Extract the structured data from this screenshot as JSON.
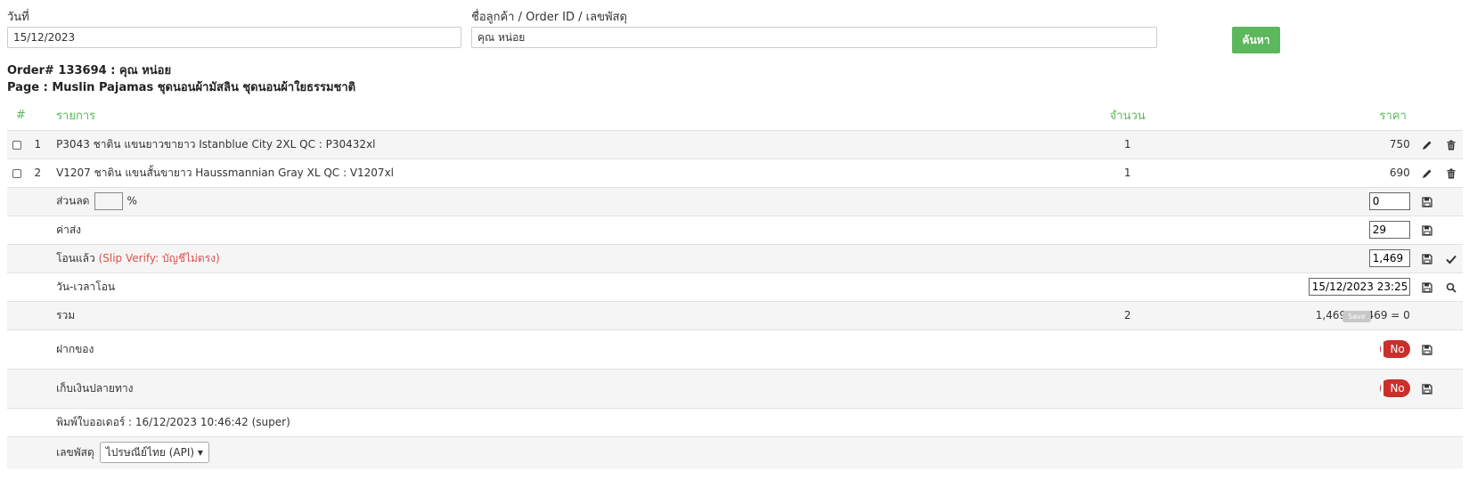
{
  "search": {
    "date_label": "วันที่",
    "date_value": "15/12/2023",
    "customer_label": "ชื่อลูกค้า / Order ID / เลขพัสดุ",
    "customer_value": "คุณ หน่อย",
    "search_label": "ค้นหา"
  },
  "order": {
    "title": "Order# 133694 : คุณ หน่อย",
    "page": "Page : Muslin Pajamas ชุดนอนผ้ามัสลิน ชุดนอนผ้าใยธรรมชาติ"
  },
  "table": {
    "headers": {
      "num": "#",
      "item": "รายการ",
      "qty": "จำนวน",
      "price": "ราคา"
    },
    "rows": [
      {
        "num": "1",
        "item": "P3043 ชาติน แขนยาวขายาว Istanblue City 2XL QC : P30432xl",
        "qty": "1",
        "price": "750"
      },
      {
        "num": "2",
        "item": "V1207 ชาติน แขนสั้นขายาว Haussmannian Gray XL QC : V1207xl",
        "qty": "1",
        "price": "690"
      }
    ]
  },
  "summary": {
    "discount_label": "ส่วนลด",
    "discount_pct_unit": "%",
    "discount_value": "0",
    "shipping_label": "ค่าส่ง",
    "shipping_value": "29",
    "transferred_label": "โอนแล้ว",
    "transferred_note": "(Slip Verify: บัญชีไม่ตรง)",
    "transferred_value": "1,469",
    "transfer_time_label": "วัน-เวลาโอน",
    "transfer_time_value": "15/12/2023 23:25",
    "total_label": "รวม",
    "total_qty": "2",
    "total_value": "1,469 - 1,469 = 0",
    "deposit_label": "ฝากของ",
    "deposit_toggle": "No",
    "cod_label": "เก็บเงินปลายทาง",
    "cod_toggle": "No",
    "printed_text": "พิมพ์ใบออเดอร์ : 16/12/2023 10:46:42 (super)",
    "tracking_label": "เลขพัสดุ",
    "tracking_carrier": "ไปรษณีย์ไทย (API)",
    "save_tooltip": "Save"
  },
  "icons": {
    "edit": "pencil-icon",
    "delete": "trash-icon",
    "save": "floppy-disk-icon",
    "check": "check-icon",
    "search": "search-icon",
    "dropdown": "chevron-down-icon"
  },
  "colors": {
    "accent": "#5cb85c",
    "danger": "#c9302c",
    "note": "#d9534f",
    "row_alt": "#f5f5f5"
  }
}
